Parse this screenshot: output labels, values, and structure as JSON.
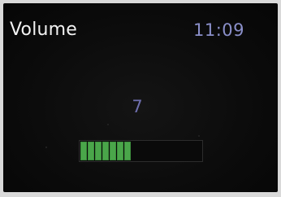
{
  "header": {
    "title": "Volume",
    "time": "11:09"
  },
  "volume": {
    "level_text": "7",
    "level": 7,
    "max_level": 16
  },
  "colors": {
    "title": "#f2f2f2",
    "time": "#8a8fc9",
    "level_text": "#6f6fae",
    "bar_fill": "#4aa64a",
    "background": "#0b0b0b"
  }
}
